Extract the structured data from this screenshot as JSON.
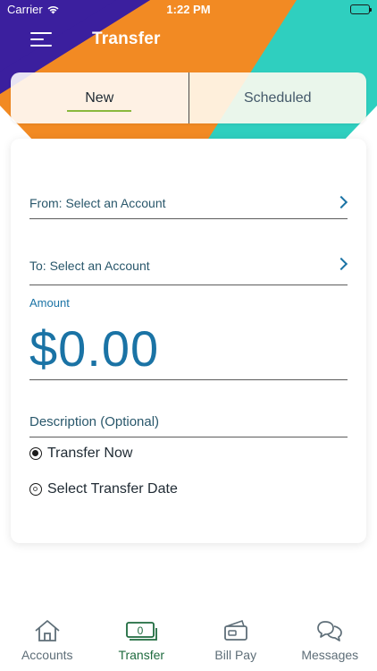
{
  "status_bar": {
    "carrier": "Carrier",
    "time": "1:22 PM"
  },
  "header": {
    "title": "Transfer",
    "menu_icon": "hamburger-menu-icon"
  },
  "colors": {
    "purple": "#3b1f9e",
    "orange": "#f28a23",
    "teal": "#2fcfbf",
    "accent_blue": "#1a73a5",
    "tab_green": "#8ab83d",
    "active_tab_text": "#1f6b3f"
  },
  "segments": {
    "new": "New",
    "scheduled": "Scheduled",
    "selected": "New"
  },
  "form": {
    "from_label": "From: Select an Account",
    "to_label": "To: Select an Account",
    "amount_label": "Amount",
    "amount_value": "$0.00",
    "description_placeholder": "Description (Optional)",
    "options": {
      "transfer_now": "Transfer Now",
      "select_date": "Select Transfer Date",
      "selected": "Transfer Now"
    }
  },
  "tab_bar": {
    "items": [
      {
        "label": "Accounts",
        "icon": "home-icon"
      },
      {
        "label": "Transfer",
        "icon": "money-transfer-icon"
      },
      {
        "label": "Bill Pay",
        "icon": "wallet-icon"
      },
      {
        "label": "Messages",
        "icon": "chat-bubbles-icon"
      }
    ],
    "active": "Transfer"
  }
}
